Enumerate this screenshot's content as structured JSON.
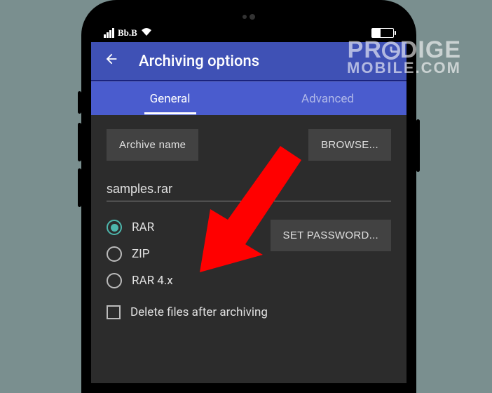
{
  "status": {
    "carrier": "Bb.B"
  },
  "header": {
    "title": "Archiving options"
  },
  "tabs": {
    "general": "General",
    "advanced": "Advanced"
  },
  "buttons": {
    "archive_name": "Archive name",
    "browse": "BROWSE...",
    "set_password": "SET PASSWORD..."
  },
  "input": {
    "filename": "samples.rar"
  },
  "radios": {
    "rar": "RAR",
    "zip": "ZIP",
    "rar4x": "RAR 4.x"
  },
  "checkbox": {
    "delete_after": "Delete files after archiving"
  },
  "watermark": {
    "line1_pre": "PR",
    "line1_post": "DIGE",
    "line2": "MOBILE.COM"
  }
}
